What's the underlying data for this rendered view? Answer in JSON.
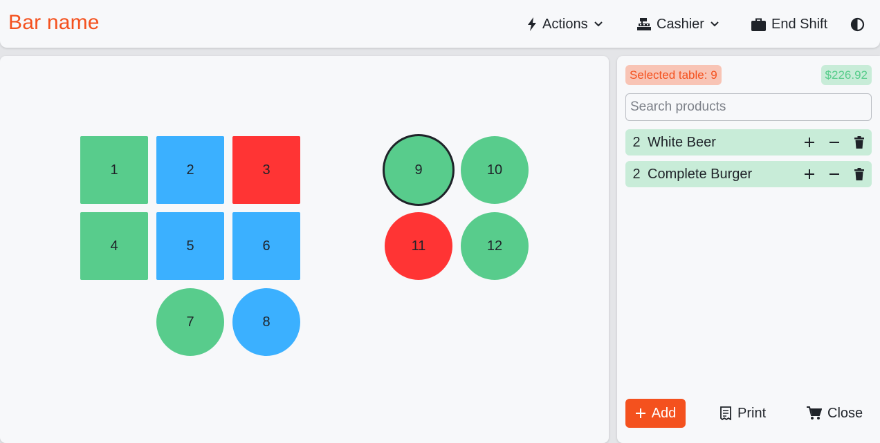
{
  "header": {
    "brand": "Bar name",
    "actions_label": "Actions",
    "cashier_label": "Cashier",
    "end_shift_label": "End Shift"
  },
  "colors": {
    "accent": "#f4511e",
    "free": "#58cc8c",
    "occupied": "#3bb0ff",
    "reserved": "#ff3434"
  },
  "tables": [
    {
      "number": "1",
      "shape": "square",
      "status": "free"
    },
    {
      "number": "2",
      "shape": "square",
      "status": "occupied"
    },
    {
      "number": "3",
      "shape": "square",
      "status": "reserved"
    },
    {
      "number": "4",
      "shape": "square",
      "status": "free"
    },
    {
      "number": "5",
      "shape": "square",
      "status": "occupied"
    },
    {
      "number": "6",
      "shape": "square",
      "status": "occupied"
    },
    {
      "number": "7",
      "shape": "round",
      "status": "free"
    },
    {
      "number": "8",
      "shape": "round",
      "status": "occupied"
    },
    {
      "number": "9",
      "shape": "round",
      "status": "free",
      "selected": true
    },
    {
      "number": "10",
      "shape": "round",
      "status": "free"
    },
    {
      "number": "11",
      "shape": "round",
      "status": "reserved"
    },
    {
      "number": "12",
      "shape": "round",
      "status": "free"
    }
  ],
  "order": {
    "selected_label": "Selected table: 9",
    "total": "$226.92",
    "search_placeholder": "Search products",
    "items": [
      {
        "qty": "2",
        "name": "White Beer"
      },
      {
        "qty": "2",
        "name": "Complete Burger"
      }
    ]
  },
  "footer": {
    "add_label": "Add",
    "print_label": "Print",
    "close_label": "Close"
  }
}
